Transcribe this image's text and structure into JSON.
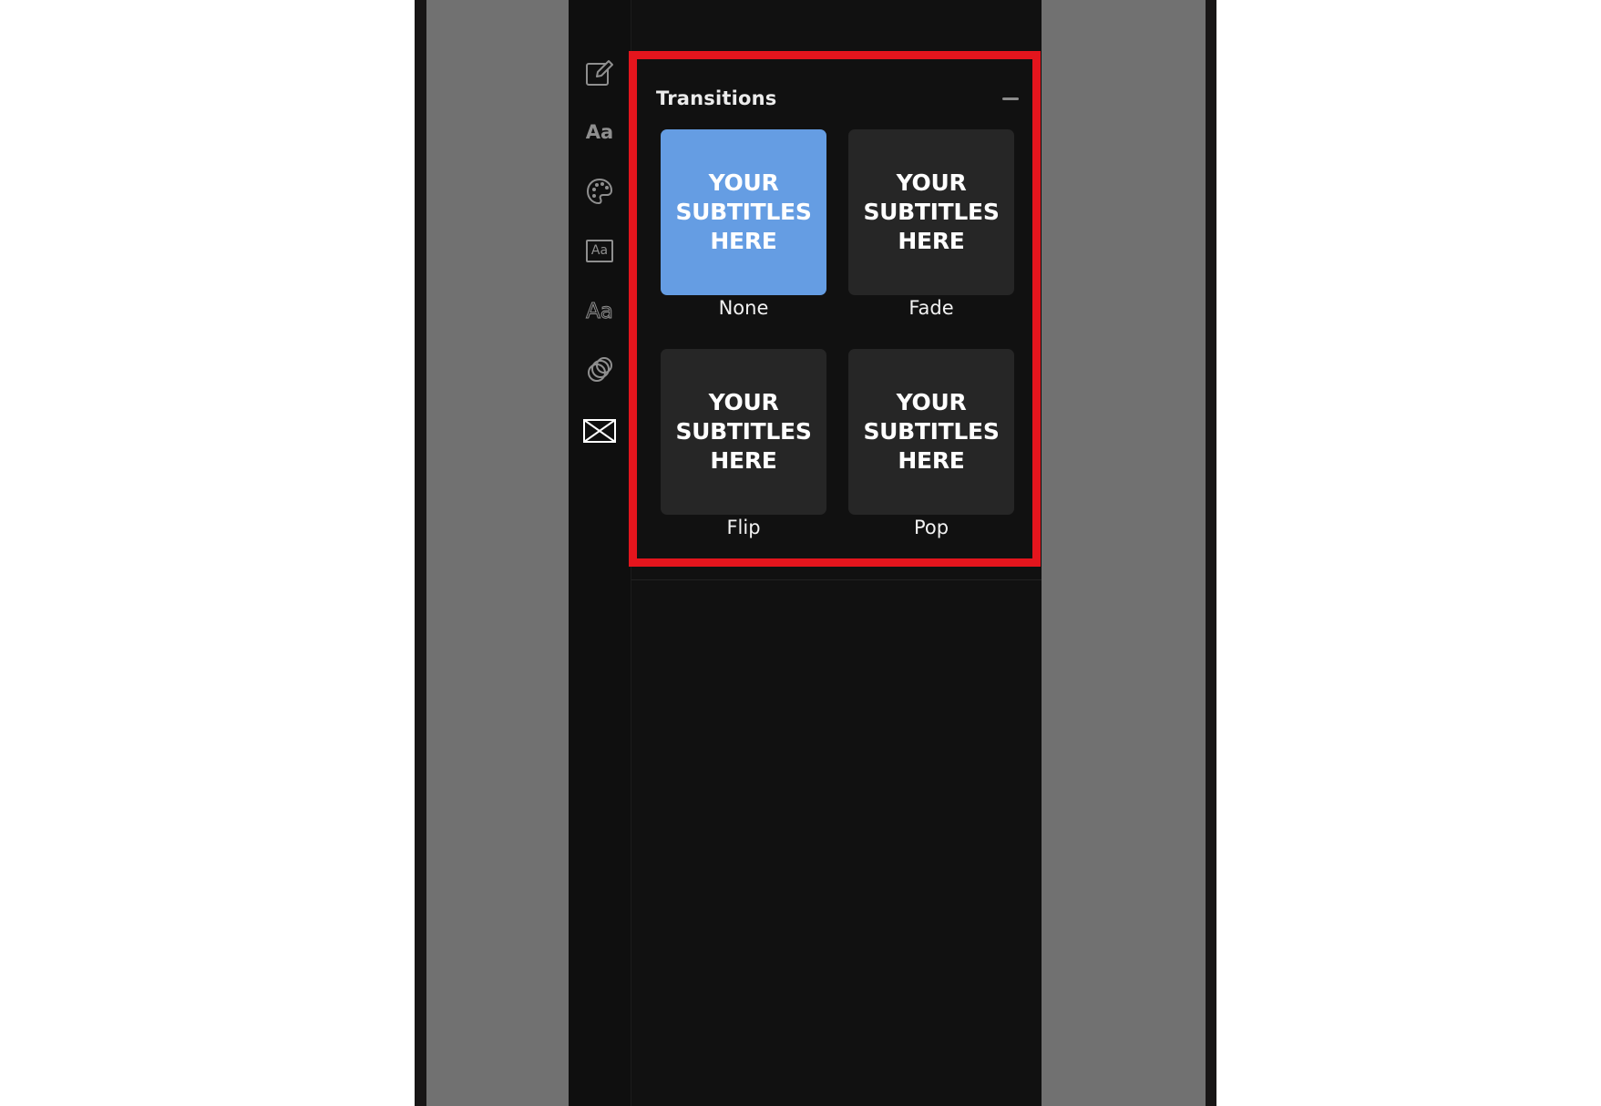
{
  "toolbar": {
    "items": [
      {
        "icon": "edit-icon"
      },
      {
        "icon": "font-icon",
        "glyph": "Aa"
      },
      {
        "icon": "palette-icon"
      },
      {
        "icon": "text-box-icon",
        "glyph": "Aa"
      },
      {
        "icon": "text-outline-icon",
        "glyph": "Aa"
      },
      {
        "icon": "effects-icon"
      },
      {
        "icon": "transitions-icon",
        "active": true
      }
    ]
  },
  "transitions": {
    "title": "Transitions",
    "collapse_icon": "minus-icon",
    "preview_text": "YOUR\nSUBTITLES\nHERE",
    "options": [
      {
        "label": "None",
        "selected": true
      },
      {
        "label": "Fade",
        "selected": false
      },
      {
        "label": "Flip",
        "selected": false
      },
      {
        "label": "Pop",
        "selected": false
      }
    ]
  },
  "colors": {
    "selected": "#659de3",
    "card": "#262626",
    "panel": "#111111",
    "highlight": "#e4151d"
  }
}
